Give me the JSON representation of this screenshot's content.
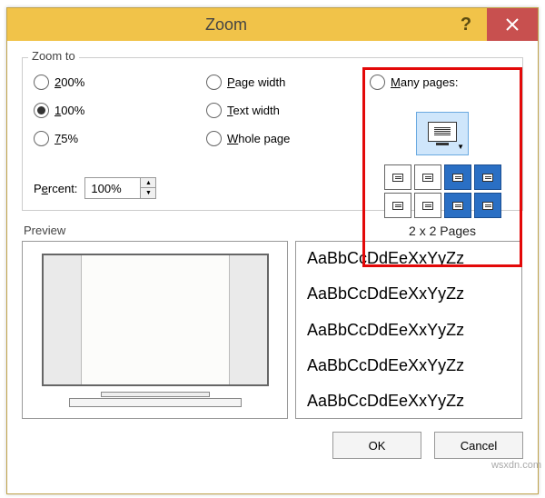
{
  "dialog": {
    "title": "Zoom",
    "help_tooltip": "?",
    "close_tooltip": "Close"
  },
  "zoom_group": {
    "title": "Zoom to",
    "radios": {
      "r200": "200%",
      "r200_accel": "2",
      "r100": "100%",
      "r100_accel": "1",
      "r75": "75%",
      "r75_accel": "7",
      "page_width": "Page width",
      "page_width_accel": "P",
      "text_width": "Text width",
      "text_width_accel": "T",
      "whole_page": "Whole page",
      "whole_page_accel": "W",
      "many_pages": "Many pages:",
      "many_pages_accel": "M"
    },
    "selected": "r100",
    "percent_label": "Percent:",
    "percent_accel": "e",
    "percent_value": "100%"
  },
  "many_pages_picker": {
    "grid_rows": 2,
    "grid_cols": 4,
    "selected_rows": 2,
    "selected_cols": 2,
    "label": "2 x 2 Pages"
  },
  "preview": {
    "label": "Preview",
    "sample_text": "AaBbCcDdEeXxYyZz"
  },
  "buttons": {
    "ok": "OK",
    "cancel": "Cancel"
  },
  "watermark": "wsxdn.com"
}
